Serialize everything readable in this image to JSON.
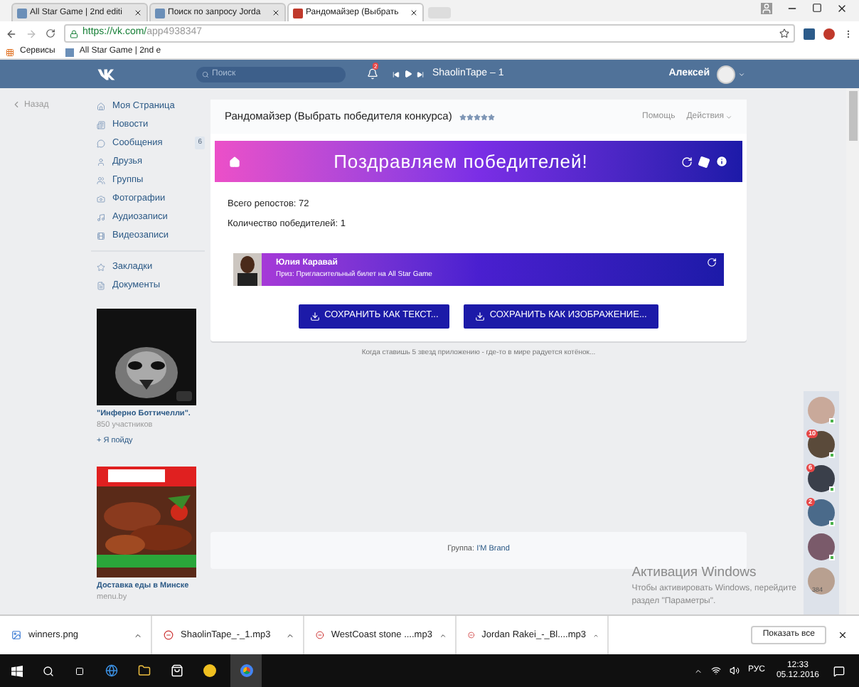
{
  "browser": {
    "tabs": [
      {
        "title": "All Star Game | 2nd editi",
        "selected": false
      },
      {
        "title": "Поиск по запросу Jorda",
        "selected": false
      },
      {
        "title": "Рандомайзер (Выбрать",
        "selected": true
      }
    ],
    "url_host": "https://vk.com/",
    "url_path": "app4938347",
    "bookmarks": [
      "Сервисы",
      "All Star Game | 2nd e"
    ]
  },
  "header": {
    "search_placeholder": "Поиск",
    "notifications": "2",
    "track": "ShaolinTape – 1",
    "user": "Алексей"
  },
  "back": "Назад",
  "menu": [
    [
      {
        "label": "Моя Страница"
      },
      {
        "label": "Новости"
      },
      {
        "label": "Сообщения",
        "count": "6"
      },
      {
        "label": "Друзья"
      },
      {
        "label": "Группы"
      },
      {
        "label": "Фотографии"
      },
      {
        "label": "Аудиозаписи"
      },
      {
        "label": "Видеозаписи"
      }
    ],
    [
      {
        "label": "Закладки"
      },
      {
        "label": "Документы"
      }
    ]
  ],
  "ads": [
    {
      "title": "\"Инферно Боттичелли\".",
      "subtitle": "850 участников",
      "action": "+ Я пойду",
      "kind": "dark"
    },
    {
      "title": "Доставка еды в Минске",
      "subtitle": "menu.by",
      "kind": "food"
    }
  ],
  "app": {
    "title": "Рандомайзер (Выбрать победителя конкурса)",
    "stars": 5,
    "links": [
      "Помощь",
      "Действия"
    ],
    "banner": "Поздравляем победителей!",
    "stats": [
      "Всего репостов: 72",
      "Количество победителей: 1"
    ],
    "winners": [
      {
        "name": "Юлия Каравай",
        "prize": "Приз: Пригласительный билет на All Star Game"
      }
    ],
    "buttons": [
      "СОХРАНИТЬ КАК ТЕКСТ...",
      "СОХРАНИТЬ КАК ИЗОБРАЖЕНИЕ..."
    ],
    "note": "Когда ставишь 5 звезд приложению - где-то в мире радуется котёнок...",
    "group_label": "Группа:",
    "group": "I'M Brand"
  },
  "chats": [
    {
      "online": true
    },
    {
      "badge": "10",
      "online": true
    },
    {
      "badge": "6",
      "online": true
    },
    {
      "badge": "2",
      "online": true
    },
    {
      "online": true
    },
    {
      "online": false,
      "count": "384"
    }
  ],
  "activation": [
    "Активация Windows",
    "Чтобы активировать Windows, перейдите",
    "раздел \"Параметры\"."
  ],
  "downloads": [
    {
      "name": "winners.png"
    },
    {
      "name": "ShaolinTape_-_1.mp3",
      "kind": "audio"
    },
    {
      "name": "WestCoast stone ....mp3",
      "kind": "audio"
    },
    {
      "name": "Jordan Rakei_-_Bl....mp3",
      "kind": "audio"
    }
  ],
  "show_all": "Показать все",
  "taskbar": {
    "language": "РУС",
    "time": "12:33",
    "date": "05.12.2016"
  }
}
